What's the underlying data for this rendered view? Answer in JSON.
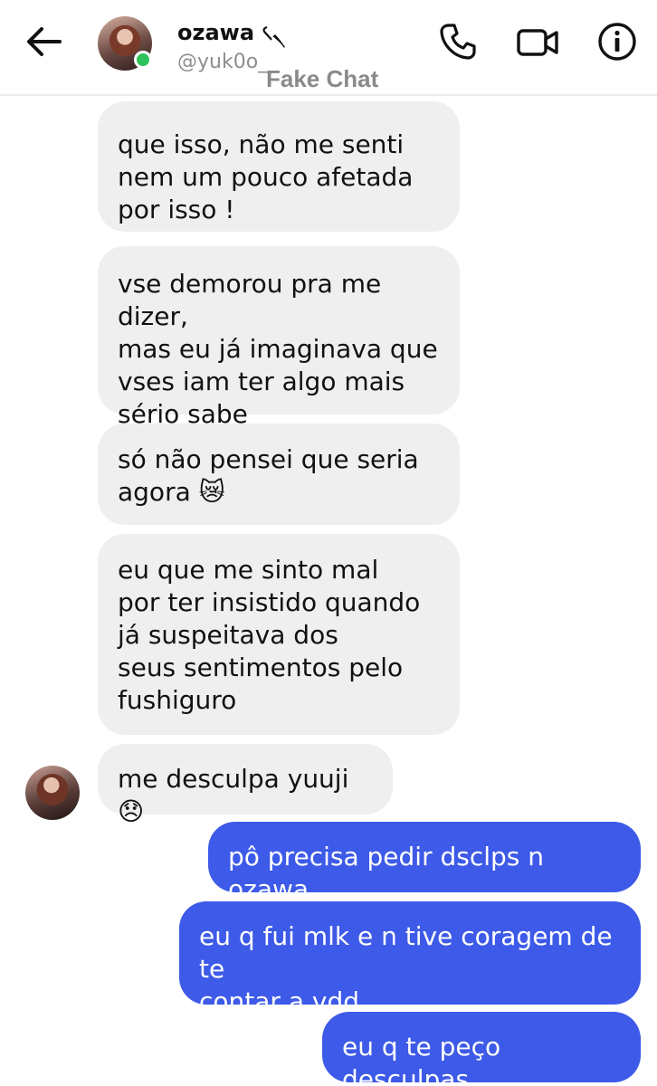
{
  "header": {
    "contact_name": "ozawa ৻৲",
    "contact_handle": "@yuk0o_",
    "watermark": "Fake Chat",
    "online": true,
    "icons": {
      "back": "arrow-left-icon",
      "call": "phone-icon",
      "video": "video-camera-icon",
      "info": "info-icon"
    }
  },
  "colors": {
    "incoming_bubble": "#efefef",
    "outgoing_bubble": "#3d5ae8",
    "online_dot": "#2ec25a"
  },
  "messages": {
    "incoming": [
      {
        "text": "que isso, não me senti\nnem um pouco afetada\npor isso !"
      },
      {
        "text": "vse demorou pra me dizer,\nmas eu já imaginava que\nvses iam ter algo mais\nsério sabe"
      },
      {
        "text": "só não pensei que seria\nagora 😿"
      },
      {
        "text": "eu que me sinto mal\npor ter insistido quando\njá suspeitava dos\nseus sentimentos pelo\nfushiguro"
      },
      {
        "text": "me desculpa yuuji 😞"
      }
    ],
    "outgoing": [
      {
        "text": "pô precisa pedir dsclps n ozawa"
      },
      {
        "text": "eu q fui mlk e n tive coragem de te\ncontar a vdd"
      },
      {
        "text": "eu q te peço desculpas"
      }
    ]
  }
}
